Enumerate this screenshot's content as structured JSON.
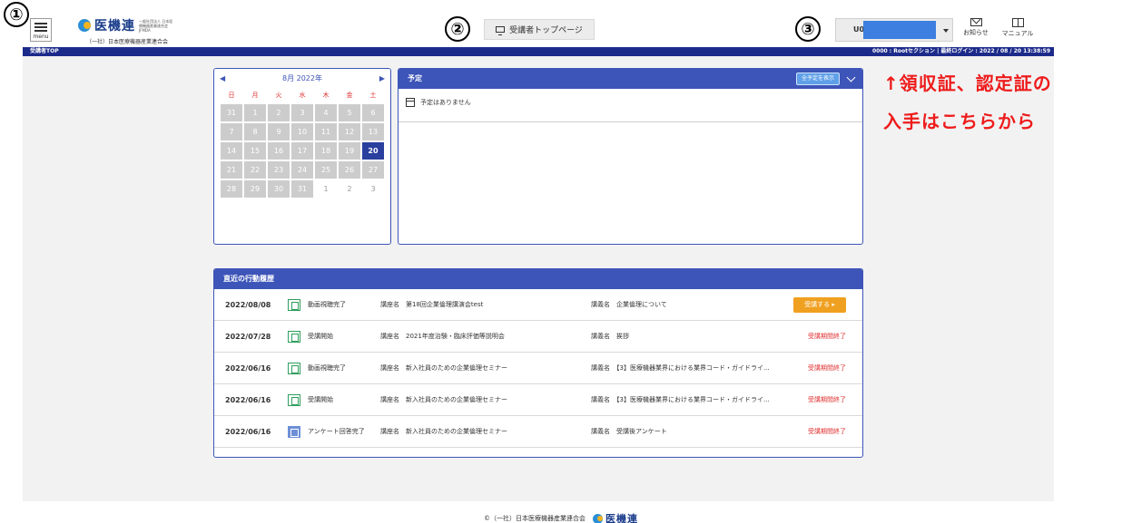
{
  "colors": {
    "nav": "#1c2b8a",
    "panel_head": "#3d55b8",
    "annotation": "#ee1b1b",
    "today": "#2a3f9e",
    "attend_button": "#f0a020"
  },
  "markers": [
    "①",
    "②",
    "③"
  ],
  "header": {
    "menu_label": "menu",
    "logo_name": "医機連",
    "logo_sub": "一般社団法人 日本医療機器産業連合会 JFMDA",
    "org_name": "（一社）日本医療機器産業連合会",
    "top_page_button": "受講者トップページ",
    "user_id": "U0",
    "news_label": "お知らせ",
    "manual_label": "マニュアル"
  },
  "navbar": {
    "title": "受講者TOP",
    "status": "0000 : Rootセクション | 最終ログイン : 2022 / 08 / 20 13:38:59"
  },
  "annotation": {
    "line1": "↑領収証、認定証の",
    "line2": "入手はこちらから"
  },
  "calendar": {
    "month_label": "8月 2022年",
    "weekdays": [
      "日",
      "月",
      "火",
      "水",
      "木",
      "金",
      "土"
    ],
    "days": [
      "31",
      "1",
      "2",
      "3",
      "4",
      "5",
      "6",
      "7",
      "8",
      "9",
      "10",
      "11",
      "12",
      "13",
      "14",
      "15",
      "16",
      "17",
      "18",
      "19",
      "20",
      "21",
      "22",
      "23",
      "24",
      "25",
      "26",
      "27",
      "28",
      "29",
      "30",
      "31",
      "1",
      "2",
      "3"
    ],
    "today": "20"
  },
  "schedule": {
    "title": "予定",
    "show_all_button": "全予定を表示",
    "empty_message": "予定はありません"
  },
  "history": {
    "title": "直近の行動履歴",
    "rows": [
      {
        "date": "2022/08/08",
        "action": "動画視聴完了",
        "course": "講座名　第18回企業倫理講演会test",
        "lecture": "講義名　企業倫理について",
        "status": "受講する ▸"
      },
      {
        "date": "2022/07/28",
        "action": "受講開始",
        "course": "講座名　2021年度治験・臨床評価等説明会",
        "lecture": "講義名　挨拶",
        "status": "受講期間終了"
      },
      {
        "date": "2022/06/16",
        "action": "動画視聴完了",
        "course": "講座名　新入社員のための企業倫理セミナー",
        "lecture": "講義名　【3】医療機器業界における業界コード・ガイドライ...",
        "status": "受講期間終了"
      },
      {
        "date": "2022/06/16",
        "action": "受講開始",
        "course": "講座名　新入社員のための企業倫理セミナー",
        "lecture": "講義名　【3】医療機器業界における業界コード・ガイドライ...",
        "status": "受講期間終了"
      },
      {
        "date": "2022/06/16",
        "action": "アンケート回答完了",
        "course": "講座名　新入社員のための企業倫理セミナー",
        "lecture": "講義名　受講後アンケート",
        "status": "受講期間終了"
      }
    ]
  },
  "footer": {
    "copyright": "©（一社）日本医療機器産業連合会",
    "logo_name": "医機連"
  }
}
